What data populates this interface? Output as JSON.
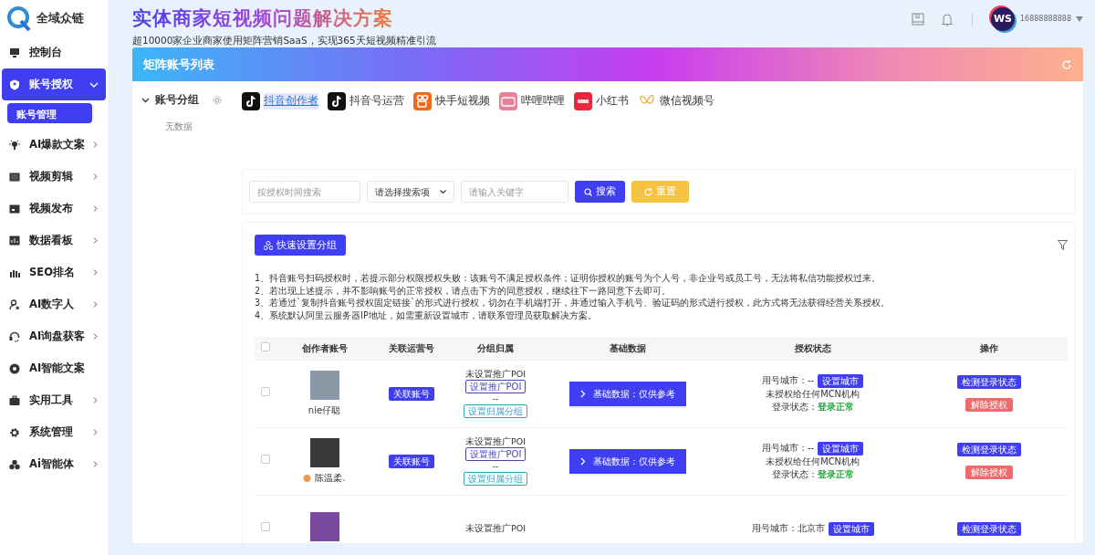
{
  "brand": {
    "name": "全域众链"
  },
  "headline": {
    "title": "实体商家短视频问题解决方案",
    "subtitle": "超10000家企业商家使用矩阵营销SaaS，实现365天短视频精准引流"
  },
  "topbar": {
    "avatar_text": "WS",
    "phone": "16888888888"
  },
  "sidebar": {
    "items": [
      {
        "label": "控制台",
        "kind": "link",
        "selected": false
      },
      {
        "label": "账号授权",
        "kind": "group",
        "selected": true,
        "expanded": true,
        "children": [
          {
            "label": "账号管理",
            "selected": true
          }
        ]
      },
      {
        "label": "AI爆款文案",
        "kind": "group",
        "selected": false,
        "expanded": false
      },
      {
        "label": "视频剪辑",
        "kind": "group",
        "selected": false,
        "expanded": false
      },
      {
        "label": "视频发布",
        "kind": "group",
        "selected": false,
        "expanded": false
      },
      {
        "label": "数据看板",
        "kind": "group",
        "selected": false,
        "expanded": false
      },
      {
        "label": "SEO排名",
        "kind": "group",
        "selected": false,
        "expanded": false
      },
      {
        "label": "AI数字人",
        "kind": "group",
        "selected": false,
        "expanded": false
      },
      {
        "label": "AI询盘获客",
        "kind": "group",
        "selected": false,
        "expanded": false
      },
      {
        "label": "AI智能文案",
        "kind": "link",
        "selected": false
      },
      {
        "label": "实用工具",
        "kind": "group",
        "selected": false,
        "expanded": false
      },
      {
        "label": "系统管理",
        "kind": "group",
        "selected": false,
        "expanded": false
      },
      {
        "label": "Ai智能体",
        "kind": "group",
        "selected": false,
        "expanded": false
      }
    ]
  },
  "card": {
    "title": "矩阵账号列表",
    "groups": {
      "title": "账号分组",
      "expanded": true,
      "empty_text": "无数据"
    },
    "platforms": [
      {
        "label": "抖音创作者",
        "kind": "douyin",
        "selected": true
      },
      {
        "label": "抖音号运营",
        "kind": "douyin",
        "selected": false
      },
      {
        "label": "快手短视频",
        "kind": "kuaishou",
        "selected": false
      },
      {
        "label": "哔哩哔哩",
        "kind": "bilibili",
        "selected": false
      },
      {
        "label": "小红书",
        "kind": "xhs",
        "selected": false
      },
      {
        "label": "微信视频号",
        "kind": "wechat",
        "selected": false
      }
    ],
    "search": {
      "time_placeholder": "按授权时间搜索",
      "select_value": "请选择搜索项",
      "keyword_placeholder": "请输入关键字",
      "search_button": "搜索",
      "reset_button": "重置"
    },
    "quick_group_button": "快速设置分组",
    "notes": [
      "1、抖音账号扫码授权时，若提示部分权限授权失败：该账号不满足授权条件；证明你授权的账号为个人号，非企业号或员工号，无法将私信功能授权过来。",
      "2、若出现上述提示，并不影响账号的正常授权，请点击下方的同意授权，继续往下一路同意下去即可。",
      "3、若通过`复制抖音账号授权固定链接`的形式进行授权，切勿在手机端打开，并通过输入手机号、验证码的形式进行授权，此方式将无法获得经营关系授权。",
      "4、系统默认阿里云服务器IP地址，如需重新设置城市，请联系管理员获取解决方案。"
    ],
    "table": {
      "select_all_checked": false,
      "columns": [
        "创作者账号",
        "关联运营号",
        "分组归属",
        "基础数据",
        "授权状态",
        "操作"
      ],
      "rows": [
        {
          "checked": false,
          "name": "nie仔聪",
          "badge": false,
          "link_button": "关联账号",
          "poi_status": "未设置推广POI",
          "poi_button": "设置推广POI",
          "group": "--",
          "group_button": "设置归属分组",
          "basic_button": "基础数据：仅供参考",
          "city": "用号城市：--",
          "city_button": "设置城市",
          "mcn": "未授权给任何MCN机构",
          "login_label": "登录状态：",
          "login_status": "登录正常",
          "check_button": "检测登录状态",
          "revoke_button": "解除授权"
        },
        {
          "checked": false,
          "name": "陈温柔.",
          "badge": true,
          "link_button": "关联账号",
          "poi_status": "未设置推广POI",
          "poi_button": "设置推广POI",
          "group": "--",
          "group_button": "设置归属分组",
          "basic_button": "基础数据：仅供参考",
          "city": "用号城市：--",
          "city_button": "设置城市",
          "mcn": "未授权给任何MCN机构",
          "login_label": "登录状态：",
          "login_status": "登录正常",
          "check_button": "检测登录状态",
          "revoke_button": "解除授权"
        },
        {
          "checked": false,
          "poi_status": "未设置推广POI",
          "city": "用号城市：北京市",
          "city_button": "设置城市",
          "check_button": "检测登录状态"
        }
      ]
    }
  }
}
